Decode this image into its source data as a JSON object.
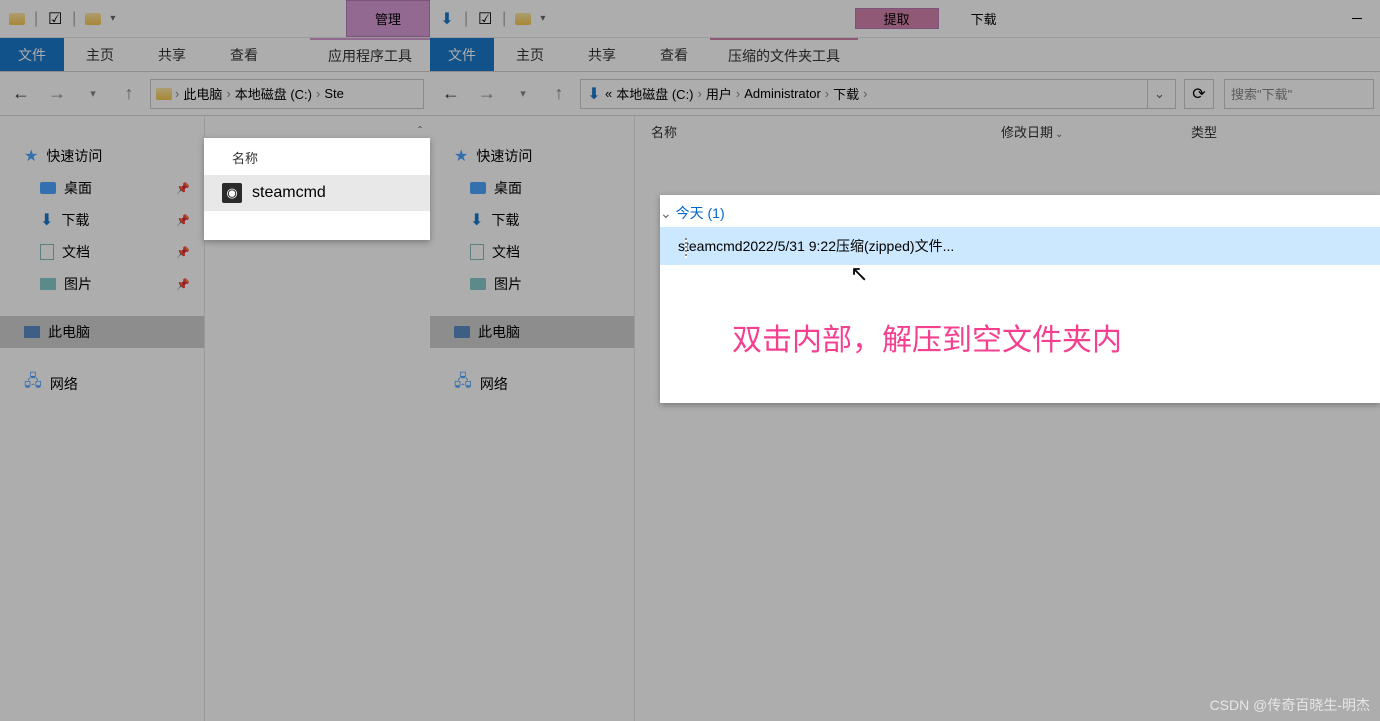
{
  "left_window": {
    "contextual_tab": "管理",
    "file_tab": "文件",
    "tabs": [
      "主页",
      "共享",
      "查看"
    ],
    "context_tab": "应用程序工具",
    "breadcrumb": {
      "root": "此电脑",
      "drive": "本地磁盘 (C:)",
      "last": "Ste"
    },
    "sidebar": {
      "quick": "快速访问",
      "desktop": "桌面",
      "downloads": "下载",
      "documents": "文档",
      "pictures": "图片",
      "thispc": "此电脑",
      "network": "网络"
    },
    "cutout": {
      "col_name": "名称",
      "file": "steamcmd"
    }
  },
  "right_window": {
    "contextual_tab": "提取",
    "title": "下载",
    "file_tab": "文件",
    "tabs": [
      "主页",
      "共享",
      "查看"
    ],
    "context_tab": "压缩的文件夹工具",
    "breadcrumb": {
      "prefix": "«",
      "drive": "本地磁盘 (C:)",
      "users": "用户",
      "admin": "Administrator",
      "downloads": "下载"
    },
    "search_placeholder": "搜索\"下载\"",
    "columns": {
      "name": "名称",
      "date": "修改日期",
      "type": "类型"
    },
    "group_today": "今天 (1)",
    "file": {
      "name": "steamcmd",
      "date": "2022/5/31 9:22",
      "type": "压缩(zipped)文件..."
    },
    "sidebar": {
      "quick": "快速访问",
      "desktop": "桌面",
      "downloads": "下载",
      "documents": "文档",
      "pictures": "图片",
      "thispc": "此电脑",
      "network": "网络"
    },
    "annotation": "双击内部，解压到空文件夹内"
  },
  "watermark": "CSDN @传奇百晓生-明杰"
}
